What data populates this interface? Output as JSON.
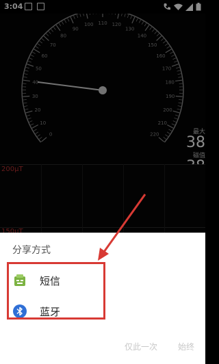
{
  "status_bar": {
    "time": "3:04",
    "icons": [
      "image-notification-icon",
      "store-notification-icon",
      "phone-wifi-icon",
      "wifi-icon",
      "signal-icon",
      "battery-icon"
    ]
  },
  "gauge": {
    "scale_labels": [
      "0",
      "10",
      "20",
      "30",
      "40",
      "50",
      "60",
      "70",
      "80",
      "90",
      "100",
      "110",
      "120",
      "130",
      "140",
      "150",
      "160",
      "170",
      "180",
      "190",
      "200",
      "210",
      "220"
    ],
    "needle_value": 40,
    "colors": {
      "dial": "#8a8a8a",
      "needle": "#cfcfcf"
    }
  },
  "side_readings": {
    "max_label": "最大",
    "max_value": "38",
    "field_label": "磁值",
    "field_value": "38"
  },
  "graph": {
    "top_label": "200µT",
    "bottom_label": "150µT",
    "color": "#b33333"
  },
  "share_sheet": {
    "title": "分享方式",
    "items": [
      {
        "label": "短信",
        "icon": "messaging-app-icon",
        "color": "#7cb342"
      },
      {
        "label": "蓝牙",
        "icon": "bluetooth-icon",
        "color": "#2f6fd6"
      }
    ],
    "actions": {
      "once": "仅此一次",
      "always": "始终"
    }
  },
  "annotation": {
    "color": "#d83a34"
  }
}
